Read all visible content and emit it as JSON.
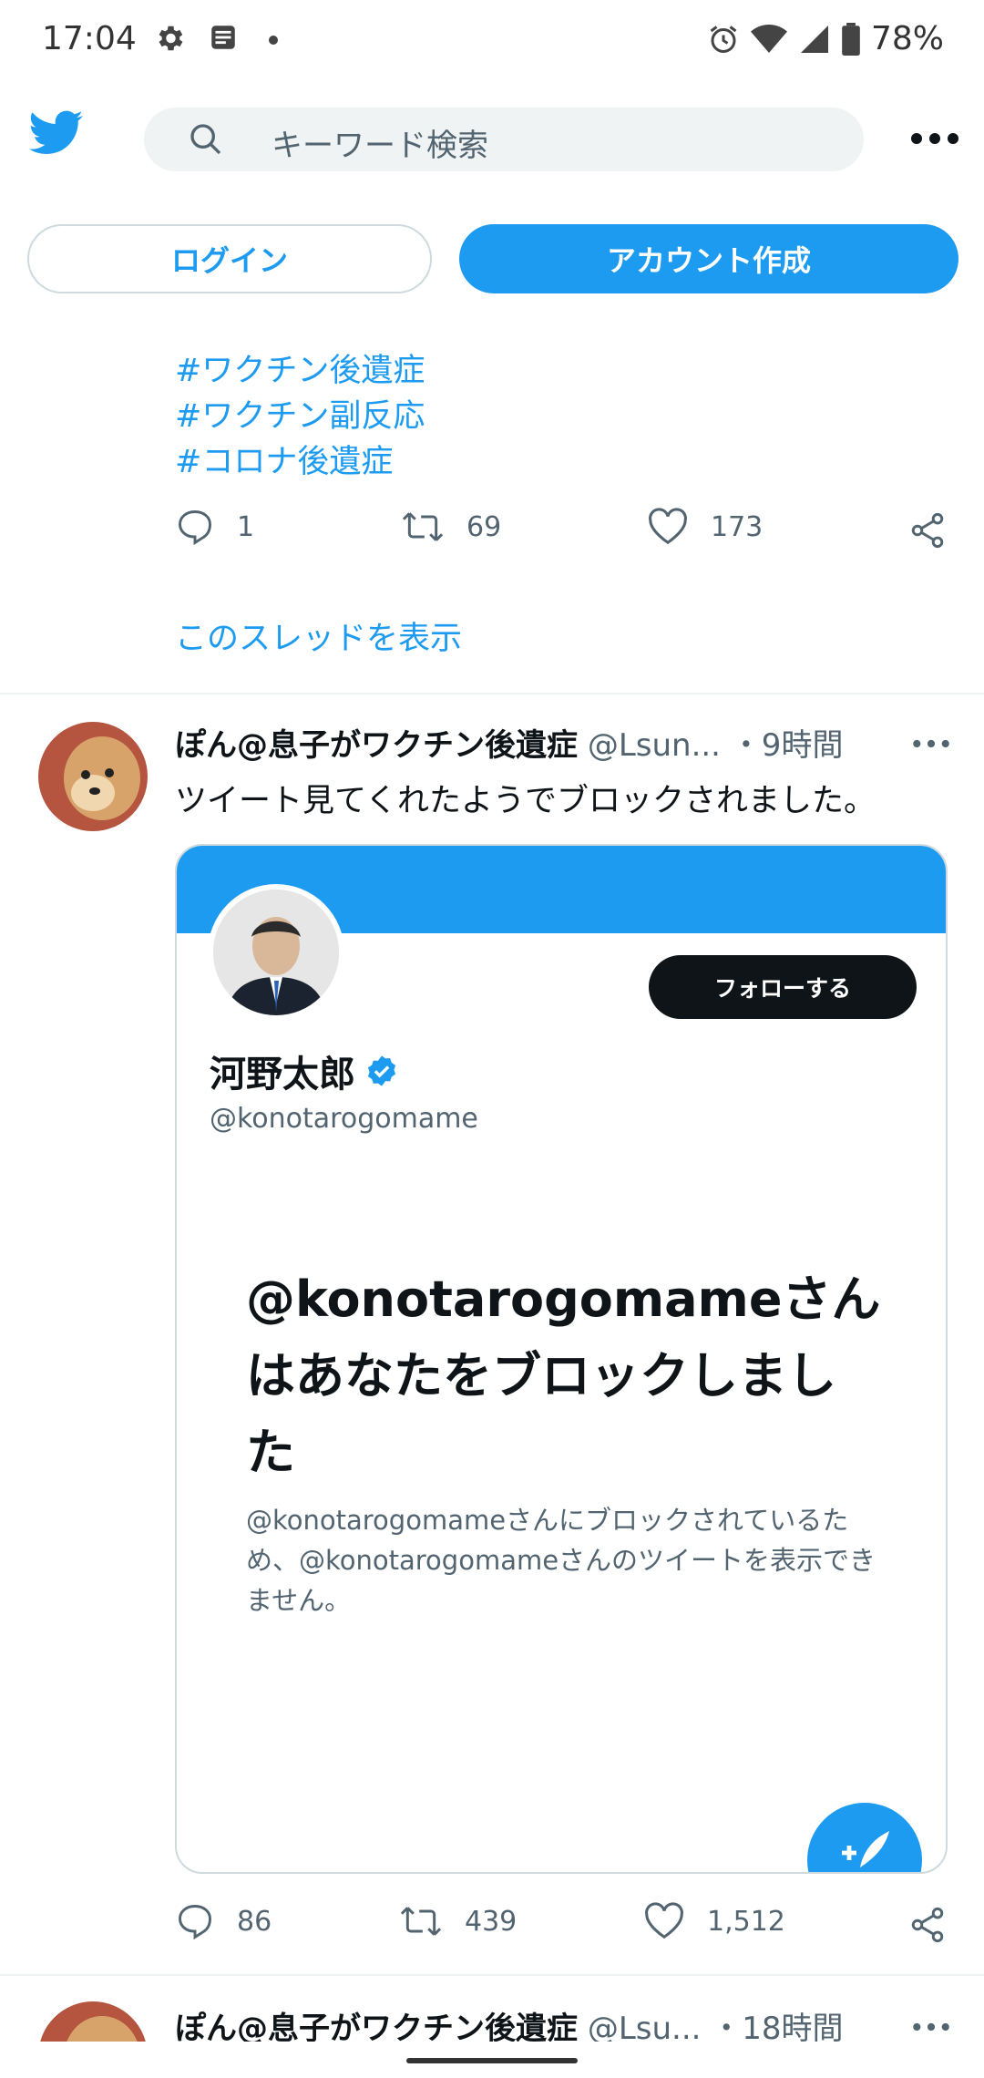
{
  "status_bar": {
    "time": "17:04",
    "battery": "78%",
    "left_icons": [
      "gear-icon",
      "news-icon",
      "dot-icon"
    ],
    "right_icons": [
      "alarm-icon",
      "wifi-icon",
      "signal-icon",
      "battery-icon"
    ]
  },
  "header": {
    "logo": "twitter-bird-icon",
    "search_placeholder": "キーワード検索",
    "more_icon": "more-icon"
  },
  "auth": {
    "login_label": "ログイン",
    "signup_label": "アカウント作成"
  },
  "tweet1": {
    "hashtags": [
      "#ワクチン後遺症",
      "#ワクチン副反応",
      "#コロナ後遺症"
    ],
    "replies": "1",
    "retweets": "69",
    "likes": "173",
    "show_thread": "このスレッドを表示"
  },
  "tweet2": {
    "name": "ぽん@息子がワクチン後遺症",
    "handle": "@Lsun...",
    "time": "・9時間",
    "text": "ツイート見てくれたようでブロックされました。",
    "card": {
      "follow_label": "フォローする",
      "profile_name": "河野太郎",
      "profile_handle": "@konotarogomame",
      "blocked_title": "@konotarogomameさんはあなたをブロックしました",
      "blocked_desc": "@konotarogomameさんにブロックされているため、@konotarogomameさんのツイートを表示できません。"
    },
    "replies": "86",
    "retweets": "439",
    "likes": "1,512"
  },
  "tweet3": {
    "name": "ぽん@息子がワクチン後遺症",
    "handle": "@Lsu...",
    "time": "・18時間"
  },
  "colors": {
    "accent": "#1d9bf0",
    "text": "#0f1419",
    "muted": "#536471"
  }
}
